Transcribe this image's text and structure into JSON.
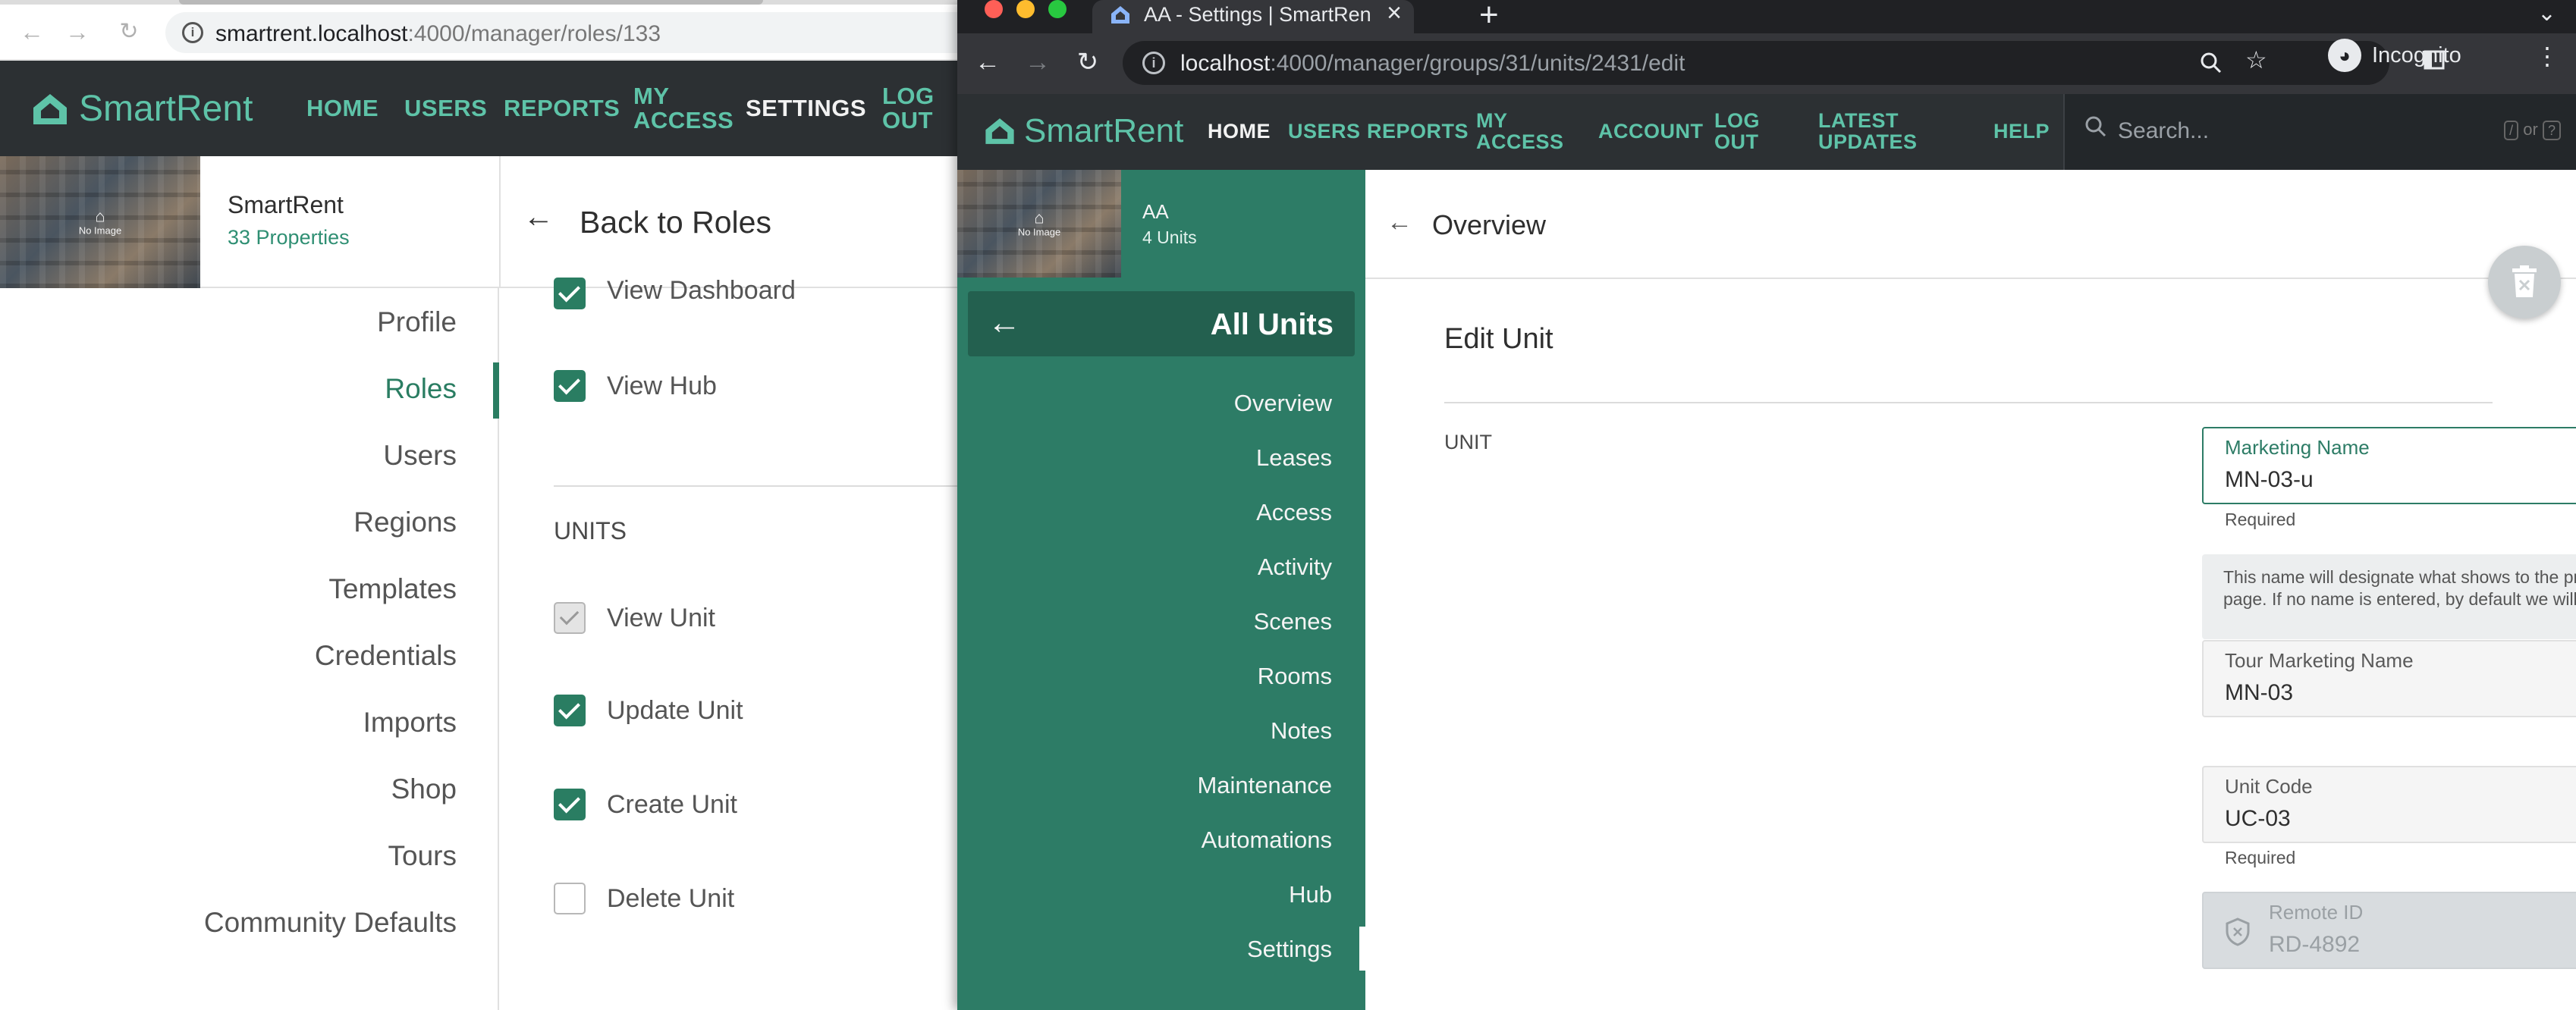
{
  "left_window": {
    "url_host": "smartrent.localhost",
    "url_rest": ":4000/manager/roles/133",
    "nav": {
      "logo_text": "SmartRent",
      "items": [
        "HOME",
        "USERS",
        "REPORTS",
        "MY",
        "ACCESS",
        "SETTINGS",
        "LOG",
        "OUT"
      ]
    },
    "property": {
      "name": "SmartRent",
      "count": "33 Properties",
      "no_image": "No Image"
    },
    "back_label": "Back to Roles",
    "sidebar": [
      "Profile",
      "Roles",
      "Users",
      "Regions",
      "Templates",
      "Credentials",
      "Imports",
      "Shop",
      "Tours",
      "Community Defaults"
    ],
    "permissions": {
      "top_items": [
        {
          "label": "View Dashboard",
          "state": "checked"
        },
        {
          "label": "View Hub",
          "state": "checked"
        }
      ],
      "units_heading": "UNITS",
      "unit_items": [
        {
          "label": "View Unit",
          "state": "disabled-checked"
        },
        {
          "label": "Update Unit",
          "state": "checked"
        },
        {
          "label": "Create Unit",
          "state": "checked"
        },
        {
          "label": "Delete Unit",
          "state": "unchecked"
        }
      ]
    }
  },
  "right_window": {
    "tab_title": "AA - Settings | SmartRent Man",
    "url_host": "localhost",
    "url_rest": ":4000/manager/groups/31/units/2431/edit",
    "incognito_label": "Incognito",
    "nav": {
      "logo_text": "SmartRent",
      "items": [
        "HOME",
        "USERS",
        "REPORTS",
        "MY",
        "ACCESS",
        "ACCOUNT",
        "LOG",
        "OUT",
        "LATEST",
        "UPDATES",
        "HELP"
      ],
      "search_placeholder": "Search...",
      "search_hint_key": "/",
      "search_hint_or": "or",
      "search_hint_key2": "?"
    },
    "property": {
      "name": "AA",
      "count": "4 Units",
      "no_image": "No Image"
    },
    "all_units_label": "All Units",
    "sidebar": [
      "Overview",
      "Leases",
      "Access",
      "Activity",
      "Scenes",
      "Rooms",
      "Notes",
      "Maintenance",
      "Automations",
      "Hub",
      "Settings"
    ],
    "header_label": "Overview",
    "edit_title": "Edit Unit",
    "section_label": "UNIT",
    "fields": {
      "marketing_name": {
        "label": "Marketing Name",
        "value": "MN-03-u",
        "helper": "Required"
      },
      "help_text": "This name will designate what shows to the prospects on the unit selection page. If no name is entered, by default we will show the unit marketing name.",
      "tour_marketing_name": {
        "label": "Tour Marketing Name",
        "value": "MN-03"
      },
      "unit_code": {
        "label": "Unit Code",
        "value": "UC-03",
        "helper": "Required"
      },
      "remote_id": {
        "label": "Remote ID",
        "value": "RD-4892"
      }
    }
  },
  "colors": {
    "brand_green": "#2d7c66",
    "accent_teal": "#5ec3a8",
    "nav_dark": "#2c3033"
  }
}
